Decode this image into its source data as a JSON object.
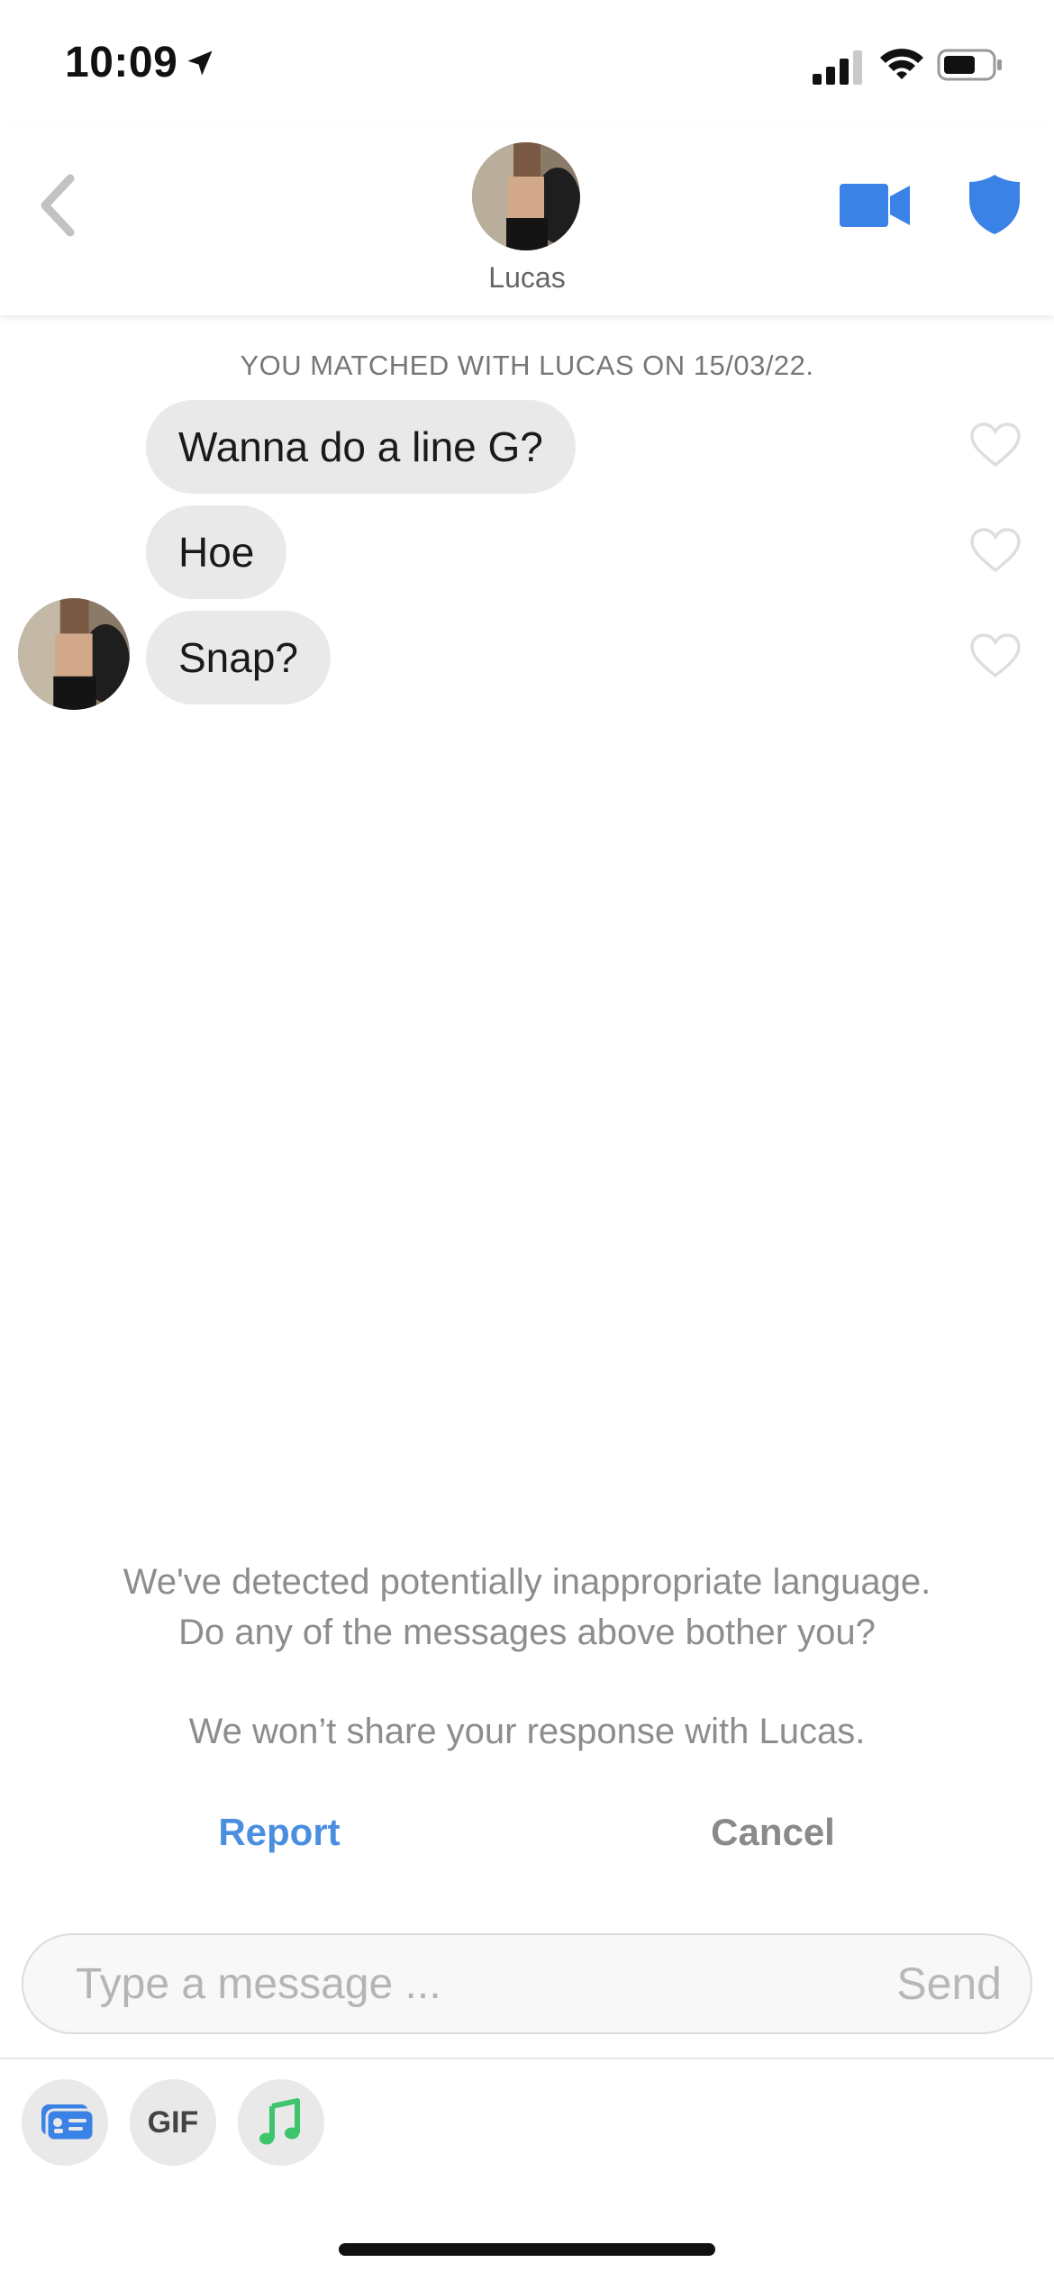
{
  "status_bar": {
    "time": "10:09",
    "icons": [
      "location-arrow-icon",
      "cellular-signal-icon",
      "wifi-icon",
      "battery-icon"
    ]
  },
  "header": {
    "back_icon": "chevron-left-icon",
    "match_name": "Lucas",
    "video_icon": "video-camera-icon",
    "safety_icon": "shield-icon",
    "accent_color": "#3b82e6"
  },
  "conversation": {
    "matched_banner": "YOU MATCHED WITH LUCAS ON 15/03/22.",
    "messages": [
      {
        "text": "Wanna do a line G?",
        "liked": false
      },
      {
        "text": "Hoe",
        "liked": false
      },
      {
        "text": "Snap?",
        "liked": false
      }
    ]
  },
  "safety_prompt": {
    "line1": "We've detected potentially inappropriate language.",
    "line2": "Do any of the messages above bother you?",
    "line3": "We won’t share your response with Lucas.",
    "report_label": "Report",
    "cancel_label": "Cancel"
  },
  "composer": {
    "placeholder": "Type a message ...",
    "value": "",
    "send_label": "Send"
  },
  "toolbar": {
    "card_icon": "profile-card-icon",
    "gif_label": "GIF",
    "music_icon": "music-note-icon"
  }
}
